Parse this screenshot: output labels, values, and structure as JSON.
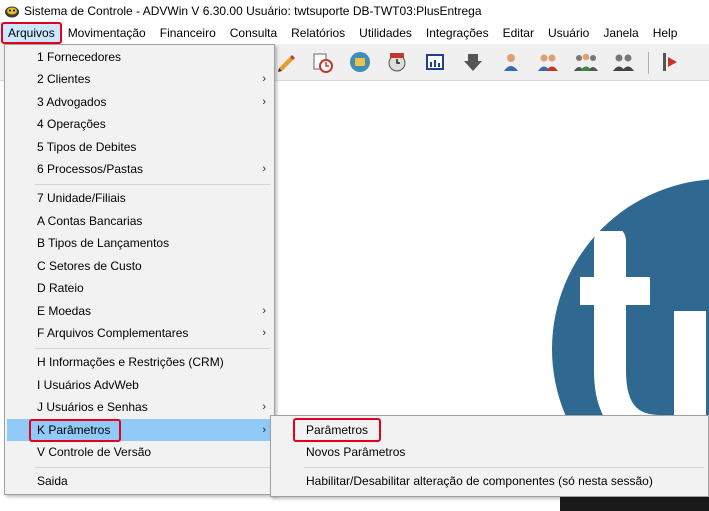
{
  "window": {
    "title": "Sistema de Controle - ADVWin  V 6.30.00  Usuário: twtsuporte  DB-TWT03:PlusEntrega"
  },
  "menubar": [
    {
      "label": "Arquivos"
    },
    {
      "label": "Movimentação"
    },
    {
      "label": "Financeiro"
    },
    {
      "label": "Consulta"
    },
    {
      "label": "Relatórios"
    },
    {
      "label": "Utilidades"
    },
    {
      "label": "Integrações"
    },
    {
      "label": "Editar"
    },
    {
      "label": "Usuário"
    },
    {
      "label": "Janela"
    },
    {
      "label": "Help"
    }
  ],
  "toolbar": {
    "icons": [
      "pencil-icon",
      "clock-icon",
      "globe-icon",
      "calendar-clock-icon",
      "report-icon",
      "arrow-down-icon",
      "user-icon",
      "users-icon",
      "user-group-icon",
      "people-icon",
      "exit-icon"
    ]
  },
  "arquivos_menu": {
    "items": [
      {
        "label": "1 Fornecedores"
      },
      {
        "label": "2 Clientes"
      },
      {
        "label": "3 Advogados"
      },
      {
        "label": "4 Operações"
      },
      {
        "label": "5 Tipos de Debites"
      },
      {
        "label": "6 Processos/Pastas"
      },
      {
        "label": "7 Unidade/Filiais"
      },
      {
        "label": "A Contas Bancarias"
      },
      {
        "label": "B Tipos de Lançamentos"
      },
      {
        "label": "C Setores de Custo"
      },
      {
        "label": "D Rateio"
      },
      {
        "label": "E Moedas"
      },
      {
        "label": "F Arquivos Complementares"
      },
      {
        "label": "H Informações e Restrições (CRM)"
      },
      {
        "label": "I Usuários AdvWeb"
      },
      {
        "label": "J Usuários e Senhas"
      },
      {
        "label": "K Parâmetros"
      },
      {
        "label": "V Controle de Versão"
      },
      {
        "label": "Saida"
      }
    ],
    "submenu_arrow": "›"
  },
  "parametros_submenu": {
    "items": [
      {
        "label": "Parâmetros"
      },
      {
        "label": "Novos Parâmetros"
      },
      {
        "label": "Habilitar/Desabilitar alteração de componentes (só nesta sessão)"
      }
    ]
  },
  "colors": {
    "highlight_border": "#e2001a",
    "selected_item": "#91c9f7",
    "logo_blue": "#2f6890"
  }
}
